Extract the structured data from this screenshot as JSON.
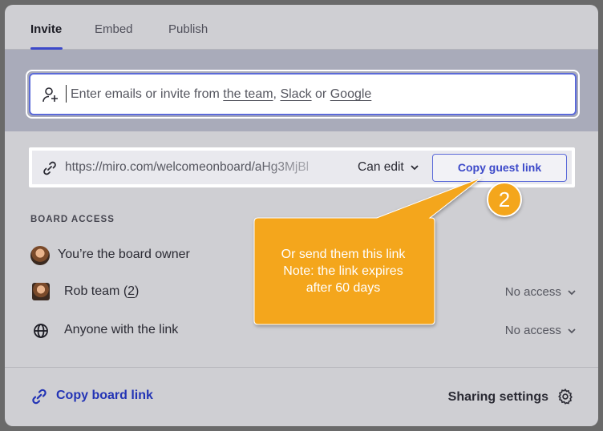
{
  "tabs": [
    {
      "label": "Invite",
      "active": true
    },
    {
      "label": "Embed",
      "active": false
    },
    {
      "label": "Publish",
      "active": false
    }
  ],
  "invite": {
    "prefix": "Enter emails or invite from ",
    "team_link": "the team",
    "comma": ",",
    "slack_link": "Slack",
    "or": "or",
    "google_link": "Google",
    "icon": "person-add-icon"
  },
  "share_link": {
    "url": "https://miro.com/welcomeonboard/aHg3MjBl",
    "permission": "Can edit",
    "copy_button": "Copy guest link",
    "icon": "link-icon"
  },
  "board_access": {
    "label": "BOARD ACCESS",
    "owner": "You’re the board owner",
    "team_prefix": "Rob team (",
    "team_count": "2",
    "team_suffix": ")",
    "team_access": "No access",
    "anyone": "Anyone with the link",
    "anyone_access": "No access"
  },
  "footer": {
    "copy_board_link": "Copy board link",
    "sharing_settings": "Sharing settings"
  },
  "callout": {
    "line1": "Or send them this link",
    "line2": "Note: the link expires",
    "line3": "after 60 days",
    "step": "2",
    "color": "#f4a61c"
  },
  "colors": {
    "accent": "#3c49c9",
    "link": "#2334b5"
  }
}
